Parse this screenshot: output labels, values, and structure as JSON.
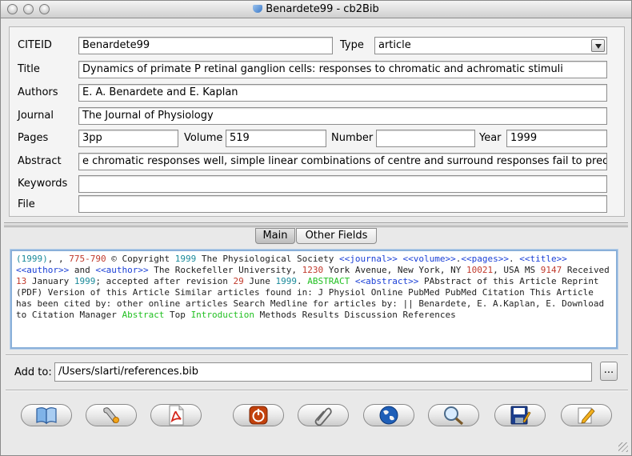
{
  "window": {
    "title": "Benardete99 - cb2Bib"
  },
  "fields": {
    "citeid": {
      "label": "CITEID",
      "value": "Benardete99"
    },
    "type": {
      "label": "Type",
      "value": "article"
    },
    "title": {
      "label": "Title",
      "value": "Dynamics of primate P retinal ganglion cells: responses to chromatic and achromatic stimuli"
    },
    "authors": {
      "label": "Authors",
      "value": "E. A. Benardete and E. Kaplan"
    },
    "journal": {
      "label": "Journal",
      "value": "The Journal of Physiology"
    },
    "pages": {
      "label": "Pages",
      "value": "3pp"
    },
    "volume": {
      "label": "Volume",
      "value": "519"
    },
    "number": {
      "label": "Number",
      "value": ""
    },
    "year": {
      "label": "Year",
      "value": "1999"
    },
    "abstract": {
      "label": "Abstract",
      "value": "e chromatic responses well, simple linear combinations of centre and surround responses fail to predict"
    },
    "keywords": {
      "label": "Keywords",
      "value": ""
    },
    "file": {
      "label": "File",
      "value": ""
    }
  },
  "tabs": [
    {
      "label": "Main",
      "active": true
    },
    {
      "label": "Other Fields",
      "active": false
    }
  ],
  "colors": {
    "number": "#c0392b",
    "tag": "#1a3fd6",
    "year": "#1a8a9a",
    "keyword": "#22c022",
    "text": "#222222"
  },
  "raw_text": [
    {
      "t": "(1999)",
      "c": "year"
    },
    {
      "t": ", , ",
      "c": "text"
    },
    {
      "t": "775-790",
      "c": "number"
    },
    {
      "t": " © Copyright ",
      "c": "text"
    },
    {
      "t": "1999",
      "c": "year"
    },
    {
      "t": " The Physiological Society ",
      "c": "text"
    },
    {
      "t": "<<journal>>",
      "c": "tag"
    },
    {
      "t": " ",
      "c": "text"
    },
    {
      "t": "<<volume>>",
      "c": "tag"
    },
    {
      "t": ".",
      "c": "text"
    },
    {
      "t": "<<pages>>",
      "c": "tag"
    },
    {
      "t": ". ",
      "c": "text"
    },
    {
      "t": "<<title>>",
      "c": "tag"
    },
    {
      "t": " ",
      "c": "text"
    },
    {
      "t": "<<author>>",
      "c": "tag"
    },
    {
      "t": " and ",
      "c": "text"
    },
    {
      "t": "<<author>>",
      "c": "tag"
    },
    {
      "t": " The Rockefeller University, ",
      "c": "text"
    },
    {
      "t": "1230",
      "c": "number"
    },
    {
      "t": " York Avenue, New York, NY ",
      "c": "text"
    },
    {
      "t": "10021",
      "c": "number"
    },
    {
      "t": ", USA MS ",
      "c": "text"
    },
    {
      "t": "9147",
      "c": "number"
    },
    {
      "t": " Received ",
      "c": "text"
    },
    {
      "t": "13",
      "c": "number"
    },
    {
      "t": " January ",
      "c": "text"
    },
    {
      "t": "1999",
      "c": "year"
    },
    {
      "t": "; accepted after revision ",
      "c": "text"
    },
    {
      "t": "29",
      "c": "number"
    },
    {
      "t": " June ",
      "c": "text"
    },
    {
      "t": "1999",
      "c": "year"
    },
    {
      "t": ". ",
      "c": "text"
    },
    {
      "t": "ABSTRACT",
      "c": "keyword"
    },
    {
      "t": " ",
      "c": "text"
    },
    {
      "t": "<<abstract>>",
      "c": "tag"
    },
    {
      "t": " PAbstract of this Article Reprint (PDF) Version of this Article Similar articles found in: J Physiol Online PubMed PubMed Citation This Article has been cited by: other online articles Search Medline for articles by: || Benardete, E. A.Kaplan, E. Download to Citation Manager ",
      "c": "text"
    },
    {
      "t": "Abstract",
      "c": "keyword"
    },
    {
      "t": " Top ",
      "c": "text"
    },
    {
      "t": "Introduction",
      "c": "keyword"
    },
    {
      "t": " Methods Results Discussion References",
      "c": "text"
    }
  ],
  "add_to": {
    "label": "Add to:",
    "value": "/Users/slarti/references.bib",
    "browse_label": "..."
  },
  "toolbar": [
    {
      "name": "view-bib-button",
      "icon": "book-icon"
    },
    {
      "name": "configure-button",
      "icon": "wrench-icon"
    },
    {
      "name": "pdf-button",
      "icon": "pdf-icon"
    },
    {
      "name": "stop-button",
      "icon": "power-icon"
    },
    {
      "name": "clipboard-button",
      "icon": "paperclip-icon"
    },
    {
      "name": "network-query-button",
      "icon": "globe-icon"
    },
    {
      "name": "search-button",
      "icon": "magnifier-icon"
    },
    {
      "name": "save-button",
      "icon": "floppy-icon"
    },
    {
      "name": "edit-button",
      "icon": "pencil-icon"
    }
  ]
}
